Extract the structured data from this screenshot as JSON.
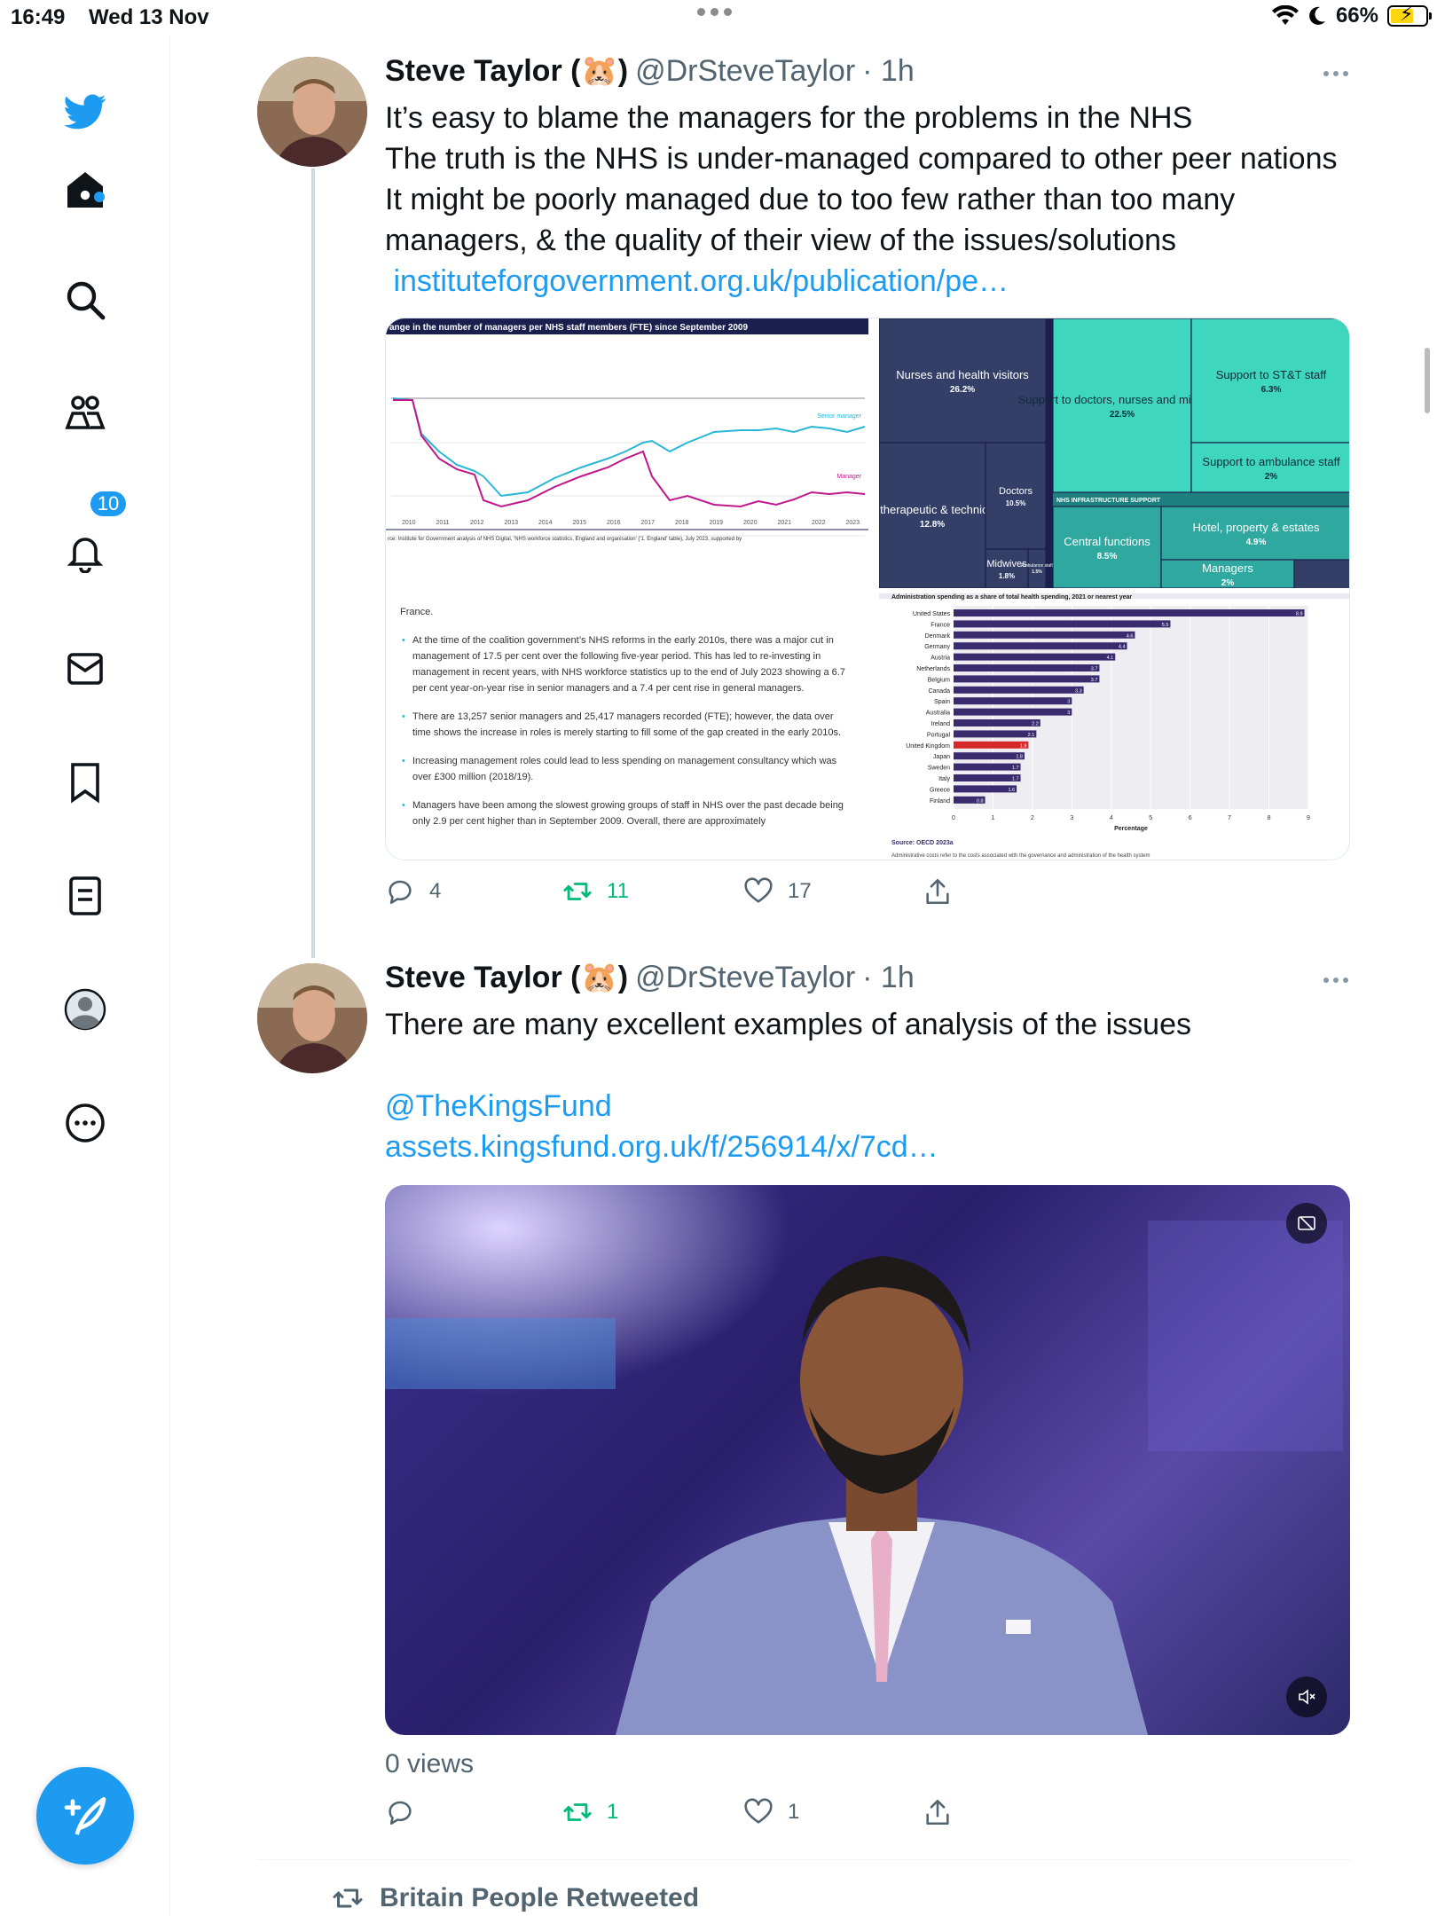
{
  "status_bar": {
    "time": "16:49",
    "date": "Wed 13 Nov",
    "battery": "66%"
  },
  "sidebar": {
    "notifications_count": "10",
    "items": [
      "home-icon",
      "search-icon",
      "communities-icon",
      "notifications-icon",
      "messages-icon",
      "bookmarks-icon",
      "lists-icon",
      "profile-icon",
      "more-icon"
    ]
  },
  "tweets": [
    {
      "name": "Steve Taylor (🐹)",
      "handle": "@DrSteveTaylor",
      "time": "· 1h",
      "text_lines": [
        "It’s easy to blame the managers for the problems in the NHS",
        "The truth is the NHS is under-managed compared to other peer nations",
        "It might be poorly managed due to too few rather than too many",
        "managers, & the quality of their view of the issues/solutions"
      ],
      "link": " instituteforgovernment.org.uk/publication/pe…",
      "replies": "4",
      "retweets": "11",
      "likes": "17",
      "media": {
        "line_chart": {
          "title": "ange in the number of managers per NHS staff members (FTE) since September 2009",
          "series_senior": "Senior manager",
          "series_manager": "Manager",
          "years": [
            "2010",
            "2011",
            "2012",
            "2013",
            "2014",
            "2015",
            "2016",
            "2017",
            "2018",
            "2019",
            "2020",
            "2021",
            "2022",
            "2023"
          ],
          "source": "rce: Institute for Government analysis of NHS Digital, 'NHS workforce statistics, England and organisation' ('1. England' table), July 2023, supported by"
        },
        "treemap": [
          {
            "label": "Nurses and health visitors",
            "value": "26.2%"
          },
          {
            "label": "Support to doctors, nurses and midwives",
            "value": "22.5%"
          },
          {
            "label": "Support to ST&T staff",
            "value": "6.3%"
          },
          {
            "label": "Support to ambulance staff",
            "value": "2%"
          },
          {
            "label": "Scientific, therapeutic & technical (ST&T)",
            "value": "12.8%"
          },
          {
            "label": "Doctors",
            "value": "10.5%"
          },
          {
            "label": "Midwives",
            "value": "1.8%"
          },
          {
            "label": "Ambulance staff",
            "value": "1.5%"
          },
          {
            "label": "Central functions",
            "value": "8.5%"
          },
          {
            "label": "Hotel, property & estates",
            "value": "4.9%"
          },
          {
            "label": "Managers",
            "value": "2%"
          }
        ],
        "treemap_header": "NHS INFRASTRUCTURE SUPPORT",
        "text_block": [
          "France.",
          "At the time of the coalition government’s NHS reforms in the early 2010s, there was a major cut in management of 17.5 per cent over the following five-year period. This has led to re-investing in management in recent years, with NHS workforce statistics up to the end of July 2023 showing a 6.7 per cent year-on-year rise in senior managers and a 7.4 per cent rise in general managers.",
          "There are 13,257 senior managers and 25,417 managers recorded (FTE); however, the data over time shows the increase in roles is merely starting to fill some of the gap created in the early 2010s.",
          "Increasing management roles could lead to less spending on management consultancy which was over £300 million (2018/19).",
          "Managers have been among the slowest growing groups of staff in NHS over the past decade being only 2.9 per cent higher than in September 2009. Overall, there are approximately"
        ],
        "bar_chart": {
          "title": "Administration spending as a share of total health spending, 2021 or nearest year",
          "countries": [
            "United States",
            "France",
            "Denmark",
            "Germany",
            "Austria",
            "Netherlands",
            "Belgium",
            "Canada",
            "Spain",
            "Australia",
            "Ireland",
            "Portugal",
            "United Kingdom",
            "Japan",
            "Sweden",
            "Italy",
            "Greece",
            "Finland"
          ],
          "values": [
            8.9,
            5.5,
            4.6,
            4.4,
            4.1,
            3.7,
            3.7,
            3.3,
            3.0,
            3.0,
            2.2,
            2.1,
            1.9,
            1.8,
            1.7,
            1.7,
            1.6,
            0.8
          ],
          "highlight": "United Kingdom",
          "ticks": [
            "0",
            "1",
            "2",
            "3",
            "4",
            "5",
            "6",
            "7",
            "8",
            "9"
          ],
          "xlabel": "Percentage",
          "source": "Source: OECD 2023a",
          "note": "Administrative costs refer to the costs associated with the governance and administration of the health system"
        }
      }
    },
    {
      "name": "Steve Taylor (🐹)",
      "handle": "@DrSteveTaylor",
      "time": "· 1h",
      "text": "There are many excellent examples of analysis of the issues",
      "mention": "@TheKingsFund",
      "link": "assets.kingsfund.org.uk/f/256914/x/7cd…",
      "views": "0 views",
      "replies": "",
      "retweets": "1",
      "likes": "1"
    }
  ],
  "next_item": {
    "retweeted_by": "Britain People Retweeted"
  },
  "colors": {
    "accent": "#1d9bf0",
    "retweet": "#00ba7c",
    "muted": "#536471"
  }
}
